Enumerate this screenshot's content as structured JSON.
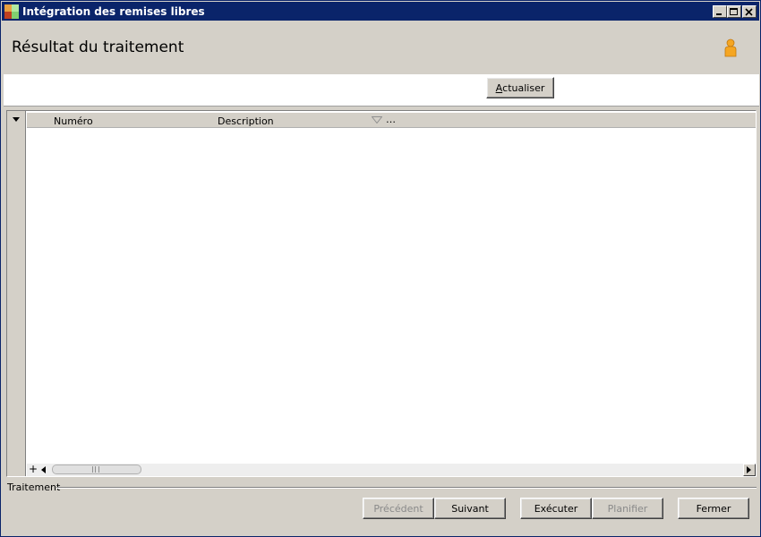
{
  "window": {
    "title": "Intégration des remises libres",
    "icon": "app-icon",
    "controls": [
      "minimize-icon",
      "maximize-icon",
      "close-icon"
    ]
  },
  "header": {
    "title": "Résultat du traitement",
    "user_icon": "user-icon"
  },
  "toolbar": {
    "refresh_label_access_key": "A",
    "refresh_label_rest": "ctualiser"
  },
  "grid": {
    "columns": [
      "Numéro",
      "Description"
    ],
    "more_label": "…",
    "rows": []
  },
  "group": {
    "label": "Traitement"
  },
  "footer": {
    "previous_label": "Précédent",
    "next_label": "Suivant",
    "execute_label": "Exécuter",
    "schedule_label": "Planifier",
    "close_label": "Fermer"
  },
  "colors": {
    "titlebar": "#0a246a",
    "face": "#d4d0c8",
    "user_icon": "#f5a623"
  }
}
